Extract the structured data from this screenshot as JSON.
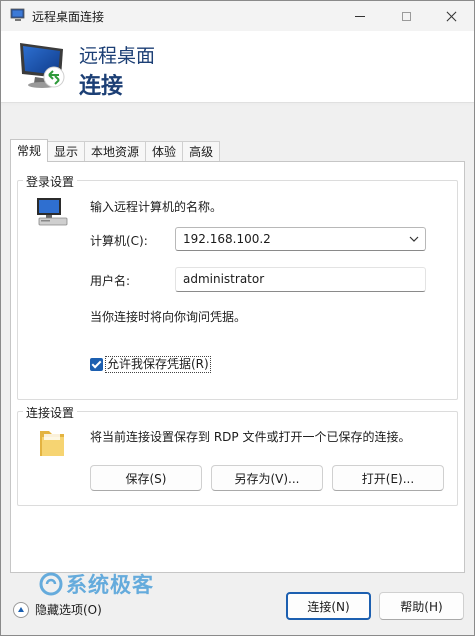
{
  "window": {
    "title": "远程桌面连接"
  },
  "banner": {
    "line1": "远程桌面",
    "line2": "连接"
  },
  "tabs": [
    {
      "label": "常规",
      "active": true
    },
    {
      "label": "显示",
      "active": false
    },
    {
      "label": "本地资源",
      "active": false
    },
    {
      "label": "体验",
      "active": false
    },
    {
      "label": "高级",
      "active": false
    }
  ],
  "login": {
    "group_label": "登录设置",
    "instruction": "输入远程计算机的名称。",
    "computer_label": "计算机(C):",
    "computer_value": "192.168.100.2",
    "username_label": "用户名:",
    "username_value": "administrator",
    "prompt_note": "当你连接时将向你询问凭据。",
    "save_credentials_label": "允许我保存凭据(R)",
    "save_credentials_checked": true
  },
  "connection": {
    "group_label": "连接设置",
    "instruction": "将当前连接设置保存到 RDP 文件或打开一个已保存的连接。",
    "save_label": "保存(S)",
    "save_as_label": "另存为(V)...",
    "open_label": "打开(E)..."
  },
  "watermark": {
    "text": "系统极客"
  },
  "footer": {
    "hide_options_label": "隐藏选项(O)",
    "connect_label": "连接(N)",
    "help_label": "帮助(H)"
  },
  "colors": {
    "accent": "#1c5fb0",
    "banner_text": "#1c3f75",
    "watermark": "#4d9fd9"
  }
}
